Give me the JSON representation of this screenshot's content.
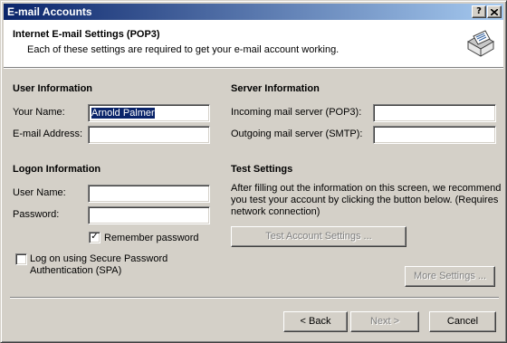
{
  "window": {
    "title": "E-mail Accounts",
    "help_button": "?",
    "close_button": "X"
  },
  "header": {
    "title": "Internet E-mail Settings (POP3)",
    "subtitle": "Each of these settings are required to get your e-mail account working.",
    "icon": "mail-envelope-icon"
  },
  "user_info": {
    "heading": "User Information",
    "name_label": "Your Name:",
    "name_value": "Arnold Palmer",
    "email_label": "E-mail Address:",
    "email_value": ""
  },
  "server_info": {
    "heading": "Server Information",
    "incoming_label": "Incoming mail server (POP3):",
    "incoming_value": "",
    "outgoing_label": "Outgoing mail server (SMTP):",
    "outgoing_value": ""
  },
  "logon_info": {
    "heading": "Logon Information",
    "username_label": "User Name:",
    "username_value": "",
    "password_label": "Password:",
    "password_value": "",
    "remember_label": "Remember password",
    "remember_checked": true,
    "spa_label": "Log on using Secure Password Authentication (SPA)",
    "spa_checked": false
  },
  "test_settings": {
    "heading": "Test Settings",
    "description": "After filling out the information on this screen, we recommend you test your account by clicking the button below. (Requires network connection)",
    "test_button": "Test Account Settings ..."
  },
  "buttons": {
    "more_settings": "More Settings ...",
    "back": "< Back",
    "next": "Next >",
    "cancel": "Cancel"
  },
  "colors": {
    "dialog_bg": "#d4d0c8",
    "titlebar_start": "#0a246a",
    "titlebar_end": "#a6caf0",
    "selection": "#0a246a"
  }
}
